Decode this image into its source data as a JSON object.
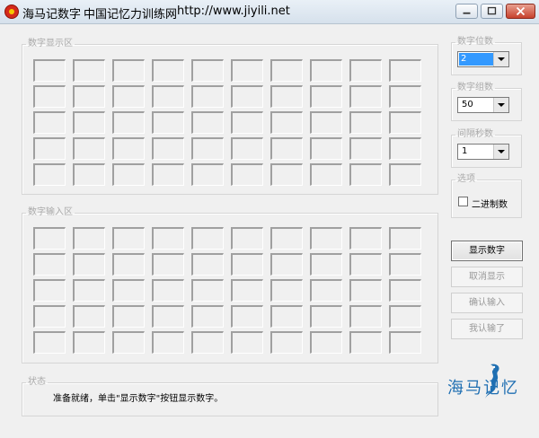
{
  "titlebar": {
    "app_name": "海马记数字",
    "org_name": "中国记忆力训练网",
    "url": "http://www.jiyili.net"
  },
  "display_area": {
    "label": "数字显示区",
    "rows": 5,
    "cols": 10
  },
  "input_area": {
    "label": "数字输入区",
    "rows": 5,
    "cols": 10
  },
  "settings": {
    "digit_count": {
      "label": "数字位数",
      "value": "2"
    },
    "group_count": {
      "label": "数字组数",
      "value": "50"
    },
    "interval_seconds": {
      "label": "间隔秒数",
      "value": "1"
    },
    "options": {
      "label": "选项",
      "binary_label": "二进制数",
      "binary_checked": false
    }
  },
  "buttons": {
    "show": "显示数字",
    "cancel": "取消显示",
    "confirm": "确认输入",
    "done": "我认输了"
  },
  "status": {
    "label": "状态",
    "message": "准备就绪，单击\"显示数字\"按钮显示数字。"
  },
  "logo": {
    "text": "海马记忆"
  },
  "colors": {
    "logo_blue": "#1f6fb2",
    "selection": "#3399ff",
    "close_red": "#c7412c"
  }
}
